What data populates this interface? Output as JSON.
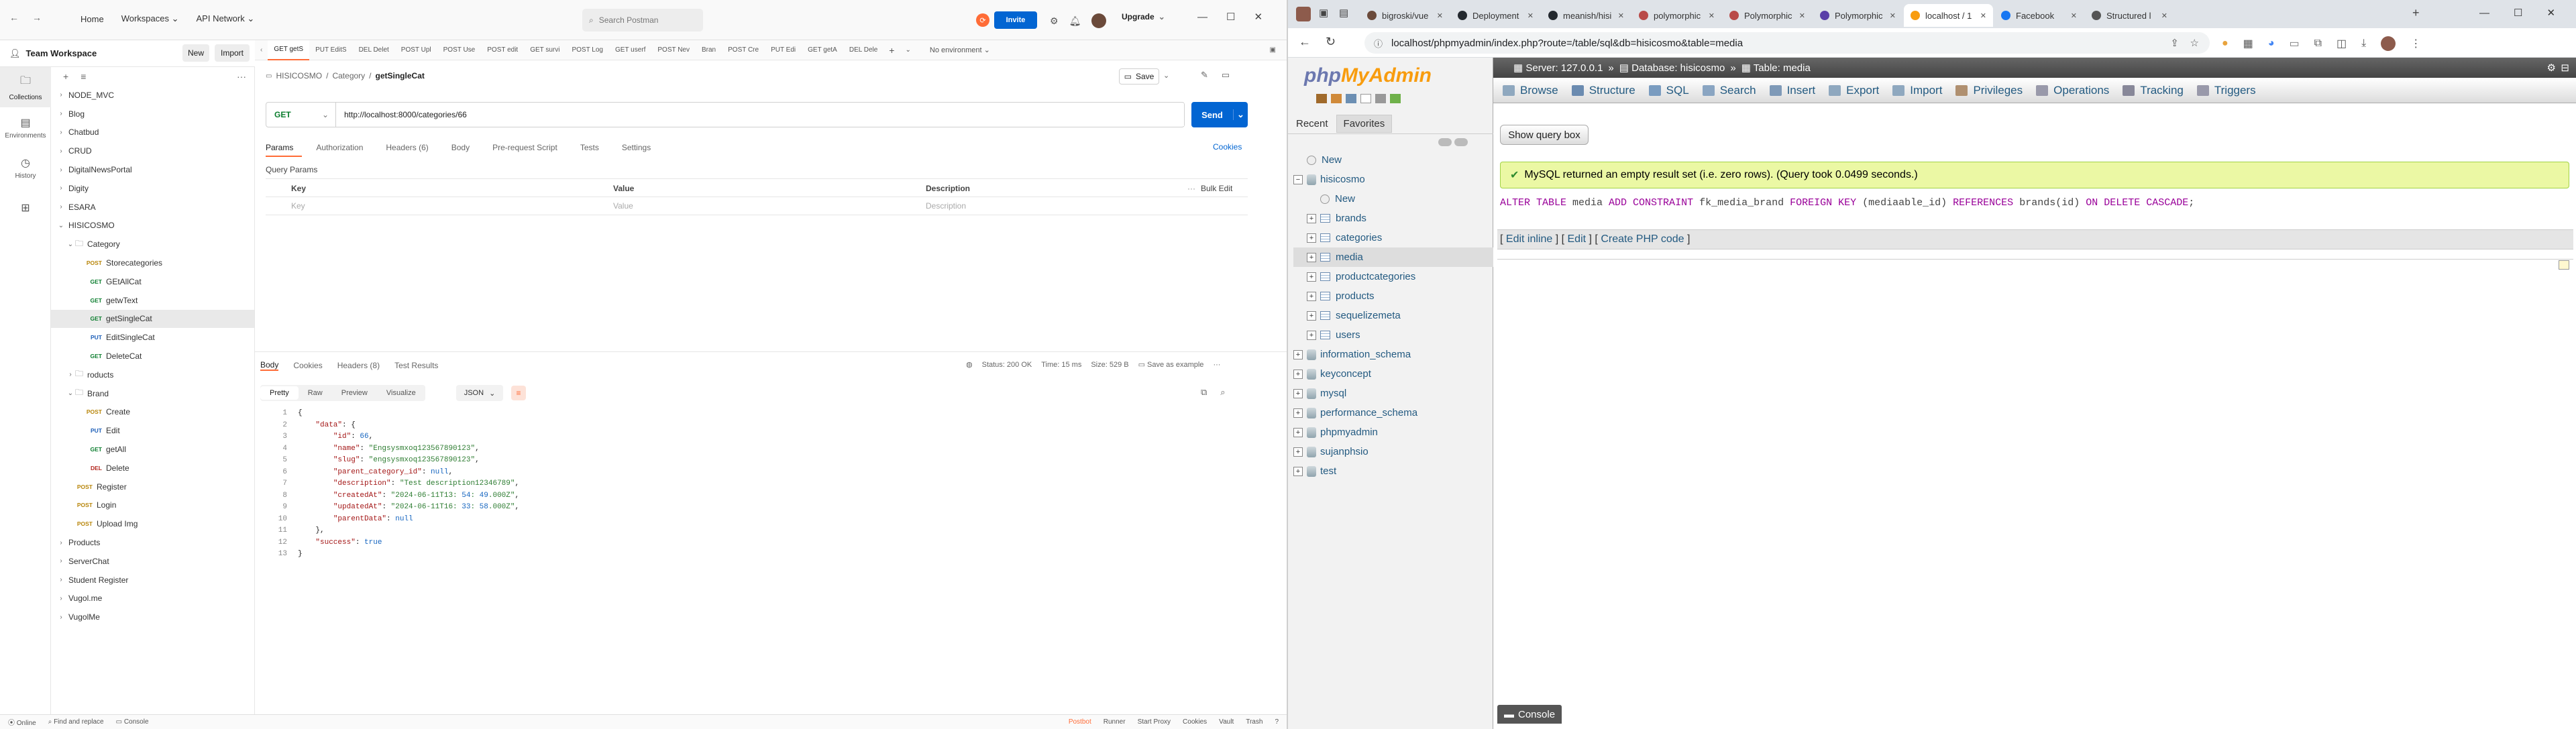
{
  "postman": {
    "nav": {
      "home": "Home",
      "workspaces": "Workspaces",
      "api_network": "API Network"
    },
    "search_placeholder": "Search Postman",
    "invite": "Invite",
    "upgrade": "Upgrade",
    "workspace_name": "Team Workspace",
    "new_label": "New",
    "import_label": "Import",
    "rail": [
      "Collections",
      "Environments",
      "History",
      ""
    ],
    "tabs": [
      "GET getS",
      "PUT EditS",
      "DEL Delet",
      "POST Upl",
      "POST Use",
      "POST edit",
      "GET survi",
      "POST Log",
      "GET userf",
      "POST Nev",
      "Bran",
      "POST Cre",
      "PUT Edi",
      "GET getA",
      "DEL Dele"
    ],
    "environment": "No environment",
    "tree": [
      {
        "label": "NODE_MVC",
        "depth": 0,
        "caret": "›",
        "method": ""
      },
      {
        "label": "Blog",
        "depth": 0,
        "caret": "›",
        "method": ""
      },
      {
        "label": "Chatbud",
        "depth": 0,
        "caret": "›",
        "method": ""
      },
      {
        "label": "CRUD",
        "depth": 0,
        "caret": "›",
        "method": ""
      },
      {
        "label": "DigitalNewsPortal",
        "depth": 0,
        "caret": "›",
        "method": ""
      },
      {
        "label": "Digity",
        "depth": 0,
        "caret": "›",
        "method": ""
      },
      {
        "label": "ESARA",
        "depth": 0,
        "caret": "›",
        "method": ""
      },
      {
        "label": "HISICOSMO",
        "depth": 0,
        "caret": "⌄",
        "method": ""
      },
      {
        "label": "Category",
        "depth": 1,
        "caret": "⌄",
        "method": "folder"
      },
      {
        "label": "Storecategories",
        "depth": 2,
        "caret": "",
        "method": "POST"
      },
      {
        "label": "GEtAllCat",
        "depth": 2,
        "caret": "",
        "method": "GET"
      },
      {
        "label": "getwText",
        "depth": 2,
        "caret": "",
        "method": "GET"
      },
      {
        "label": "getSingleCat",
        "depth": 2,
        "caret": "",
        "method": "GET"
      },
      {
        "label": "EditSingleCat",
        "depth": 2,
        "caret": "",
        "method": "PUT"
      },
      {
        "label": "DeleteCat",
        "depth": 2,
        "caret": "",
        "method": "GET"
      },
      {
        "label": "roducts",
        "depth": 1,
        "caret": "›",
        "method": "folder"
      },
      {
        "label": "Brand",
        "depth": 1,
        "caret": "⌄",
        "method": "folder"
      },
      {
        "label": "Create",
        "depth": 2,
        "caret": "",
        "method": "POST"
      },
      {
        "label": "Edit",
        "depth": 2,
        "caret": "",
        "method": "PUT"
      },
      {
        "label": "getAll",
        "depth": 2,
        "caret": "",
        "method": "GET"
      },
      {
        "label": "Delete",
        "depth": 2,
        "caret": "",
        "method": "DEL"
      },
      {
        "label": "Register",
        "depth": 1,
        "caret": "",
        "method": "POST"
      },
      {
        "label": "Login",
        "depth": 1,
        "caret": "",
        "method": "POST"
      },
      {
        "label": "Upload Img",
        "depth": 1,
        "caret": "",
        "method": "POST"
      },
      {
        "label": "Products",
        "depth": 0,
        "caret": "›",
        "method": ""
      },
      {
        "label": "ServerChat",
        "depth": 0,
        "caret": "›",
        "method": ""
      },
      {
        "label": "Student Register",
        "depth": 0,
        "caret": "›",
        "method": ""
      },
      {
        "label": "Vugol.me",
        "depth": 0,
        "caret": "›",
        "method": ""
      },
      {
        "label": "VugolMe",
        "depth": 0,
        "caret": "›",
        "method": ""
      }
    ],
    "breadcrumb": {
      "collection": "HISICOSMO",
      "folder": "Category",
      "request": "getSingleCat"
    },
    "save_label": "Save",
    "method": "GET",
    "url": "http://localhost:8000/categories/66",
    "send_label": "Send",
    "request_tabs": [
      "Params",
      "Authorization",
      "Headers (6)",
      "Body",
      "Pre-request Script",
      "Tests",
      "Settings"
    ],
    "cookies_label": "Cookies",
    "query_params_title": "Query Params",
    "params_headers": {
      "key": "Key",
      "value": "Value",
      "description": "Description",
      "bulk_edit": "Bulk Edit"
    },
    "params_placeholders": {
      "key": "Key",
      "value": "Value",
      "description": "Description"
    },
    "response_tabs": [
      "Body",
      "Cookies",
      "Headers (8)",
      "Test Results"
    ],
    "status": "Status: 200 OK",
    "time": "Time: 15 ms",
    "size": "Size: 529 B",
    "save_as_example": "Save as example",
    "view_tabs": [
      "Pretty",
      "Raw",
      "Preview",
      "Visualize"
    ],
    "format": "JSON",
    "response_lines": [
      "{",
      "    \"data\": {",
      "        \"id\": 66,",
      "        \"name\": \"Engsysmxoq123567890123\",",
      "        \"slug\": \"engsysmxoq123567890123\",",
      "        \"parent_category_id\": null,",
      "        \"description\": \"Test description12346789\",",
      "        \"createdAt\": \"2024-06-11T13:54:49.000Z\",",
      "        \"updatedAt\": \"2024-06-11T16:33:58.000Z\",",
      "        \"parentData\": null",
      "    },",
      "    \"success\": true",
      "}"
    ],
    "statusbar": {
      "online": "Online",
      "find": "Find and replace",
      "console": "Console",
      "postbot": "Postbot",
      "runner": "Runner",
      "proxy": "Start Proxy",
      "cookies": "Cookies",
      "vault": "Vault",
      "trash": "Trash"
    }
  },
  "chrome": {
    "tabs": [
      "bigroski/vue",
      "Deployment",
      "meanish/hisi",
      "polymorphic",
      "Polymorphic",
      "Polymorphic",
      "localhost / 1",
      "Facebook",
      "Structured l"
    ],
    "active_tab": 6,
    "url": "localhost/phpmyadmin/index.php?route=/table/sql&db=hisicosmo&table=media"
  },
  "pma": {
    "logo_php": "php",
    "logo_myadmin": "MyAdmin",
    "recent": "Recent",
    "favorites": "Favorites",
    "tree": [
      {
        "label": "New",
        "depth": 0,
        "kind": "new"
      },
      {
        "label": "hisicosmo",
        "depth": 0,
        "kind": "db"
      },
      {
        "label": "New",
        "depth": 1,
        "kind": "new"
      },
      {
        "label": "brands",
        "depth": 1,
        "kind": "table"
      },
      {
        "label": "categories",
        "depth": 1,
        "kind": "table"
      },
      {
        "label": "media",
        "depth": 1,
        "kind": "table"
      },
      {
        "label": "productcategories",
        "depth": 1,
        "kind": "table"
      },
      {
        "label": "products",
        "depth": 1,
        "kind": "table"
      },
      {
        "label": "sequelizemeta",
        "depth": 1,
        "kind": "table"
      },
      {
        "label": "users",
        "depth": 1,
        "kind": "table"
      },
      {
        "label": "information_schema",
        "depth": 0,
        "kind": "db"
      },
      {
        "label": "keyconcept",
        "depth": 0,
        "kind": "db"
      },
      {
        "label": "mysql",
        "depth": 0,
        "kind": "db"
      },
      {
        "label": "performance_schema",
        "depth": 0,
        "kind": "db"
      },
      {
        "label": "phpmyadmin",
        "depth": 0,
        "kind": "db"
      },
      {
        "label": "sujanphsio",
        "depth": 0,
        "kind": "db"
      },
      {
        "label": "test",
        "depth": 0,
        "kind": "db"
      }
    ],
    "breadcrumb": {
      "server": "Server: 127.0.0.1",
      "database": "Database: hisicosmo",
      "table": "Table: media"
    },
    "menu": [
      "Browse",
      "Structure",
      "SQL",
      "Search",
      "Insert",
      "Export",
      "Import",
      "Privileges",
      "Operations",
      "Tracking",
      "Triggers"
    ],
    "show_query_box": "Show query box",
    "success_message": "MySQL returned an empty result set (i.e. zero rows). (Query took 0.0499 seconds.)",
    "sql_parts": {
      "alter": "ALTER TABLE",
      "table": " media ",
      "add": "ADD CONSTRAINT",
      "name": " fk_media_brand ",
      "fk": "FOREIGN KEY",
      "col": " (mediaable_id) ",
      "ref": "REFERENCES",
      "target": " brands(id) ",
      "on": "ON DELETE CASCADE",
      "end": ";"
    },
    "edit_links": {
      "inline": "Edit inline",
      "edit": "Edit",
      "php": "Create PHP code"
    },
    "console": "Console"
  }
}
